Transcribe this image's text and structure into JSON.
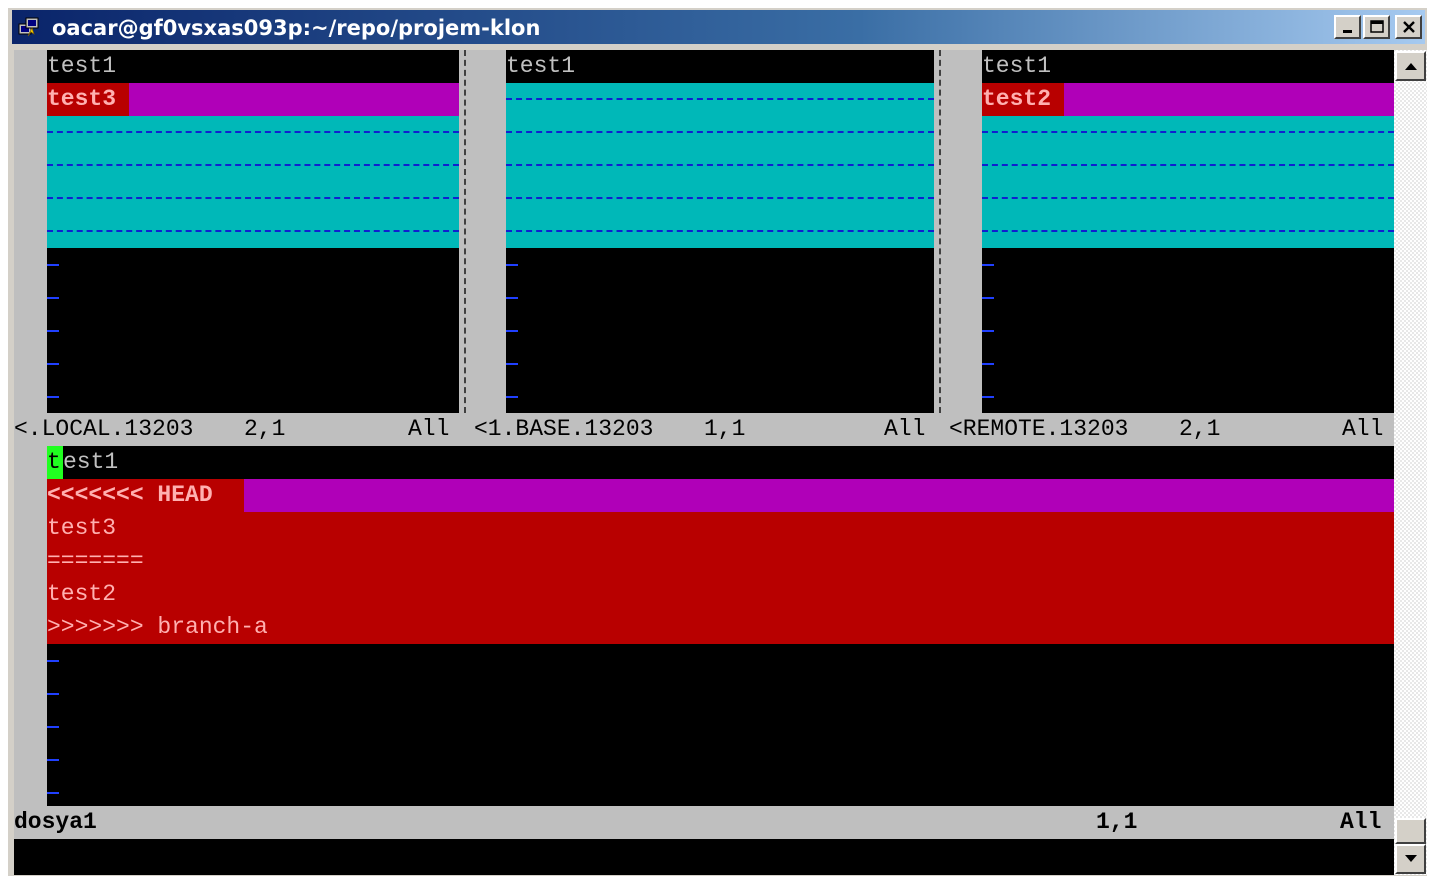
{
  "window": {
    "title": "oacar@gf0vsxas093p:~/repo/projem-klon",
    "controls": {
      "minimize": "minimize",
      "maximize": "maximize",
      "close": "close"
    }
  },
  "panes": {
    "local": {
      "line1": "test1",
      "line2": "test3"
    },
    "base": {
      "line1": "test1"
    },
    "remote": {
      "line1": "test1",
      "line2": "test2"
    },
    "separator_char": "|"
  },
  "split_status": {
    "local": {
      "name": "<.LOCAL.13203",
      "pos": "2,1",
      "scroll": "All"
    },
    "base": {
      "name": "<1.BASE.13203",
      "pos": "1,1",
      "scroll": "All"
    },
    "remote": {
      "name": "<REMOTE.13203",
      "pos": "2,1",
      "scroll": "All"
    }
  },
  "merged": {
    "cursor_char": "t",
    "line1_rest": "est1",
    "head_marker": "<<<<<<< HEAD",
    "local_line": "test3",
    "separator": "=======",
    "remote_line": "test2",
    "branch_marker": ">>>>>>> branch-a"
  },
  "bottom_status": {
    "filename": "dosya1",
    "pos": "1,1",
    "scroll": "All"
  },
  "colors": {
    "magenta": "#b000b8",
    "cyan": "#00b8b8",
    "red": "#b80000",
    "cursor_green": "#20ff20",
    "status_gray": "#bfbfbf",
    "tilde_blue": "#2040ff"
  },
  "icons": {
    "app": "putty-icon",
    "scroll_up": "arrow-up-icon",
    "scroll_down": "arrow-down-icon",
    "mouse": "ibeam-cursor-icon"
  }
}
